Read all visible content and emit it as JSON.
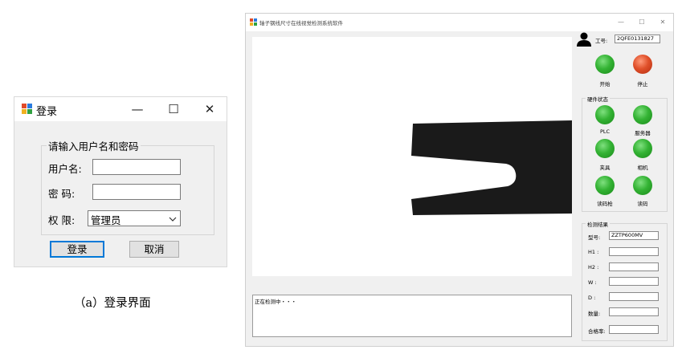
{
  "login": {
    "title": "登录",
    "window_controls": {
      "minimize": "—",
      "maximize": "☐",
      "close": "✕"
    },
    "group_caption": "请输入用户名和密码",
    "username_label": "用户名:",
    "username_value": "",
    "password_label": "密  码:",
    "password_value": "",
    "role_label": "权  限:",
    "role_value": "管理员",
    "login_button": "登录",
    "cancel_button": "取消"
  },
  "caption": "（a）登录界面",
  "main": {
    "title": "轴子钢线尺寸在线视觉检测系统软件",
    "window_controls": {
      "minimize": "—",
      "maximize": "☐",
      "close": "✕"
    },
    "operator_label": "工号:",
    "operator_value": "2QFE0131827",
    "start_label": "开始",
    "stop_label": "停止",
    "hardware_group": "硬件状态",
    "hardware": [
      {
        "label": "PLC"
      },
      {
        "label": "服务器"
      },
      {
        "label": "夹具"
      },
      {
        "label": "相机"
      },
      {
        "label": "读码枪"
      },
      {
        "label": "读码"
      }
    ],
    "results_group": "检测结果",
    "fields": [
      {
        "label": "型号:",
        "value": "ZZTP600MV"
      },
      {
        "label": "H1 :",
        "value": ""
      },
      {
        "label": "H2 :",
        "value": ""
      },
      {
        "label": "W :",
        "value": ""
      },
      {
        "label": "D :",
        "value": ""
      },
      {
        "label": "数量:",
        "value": ""
      },
      {
        "label": "合格率:",
        "value": ""
      }
    ],
    "log_text": "正在检测中・・・",
    "colors": {
      "led_on": "#34b334",
      "led_stop": "#e0502a"
    }
  }
}
